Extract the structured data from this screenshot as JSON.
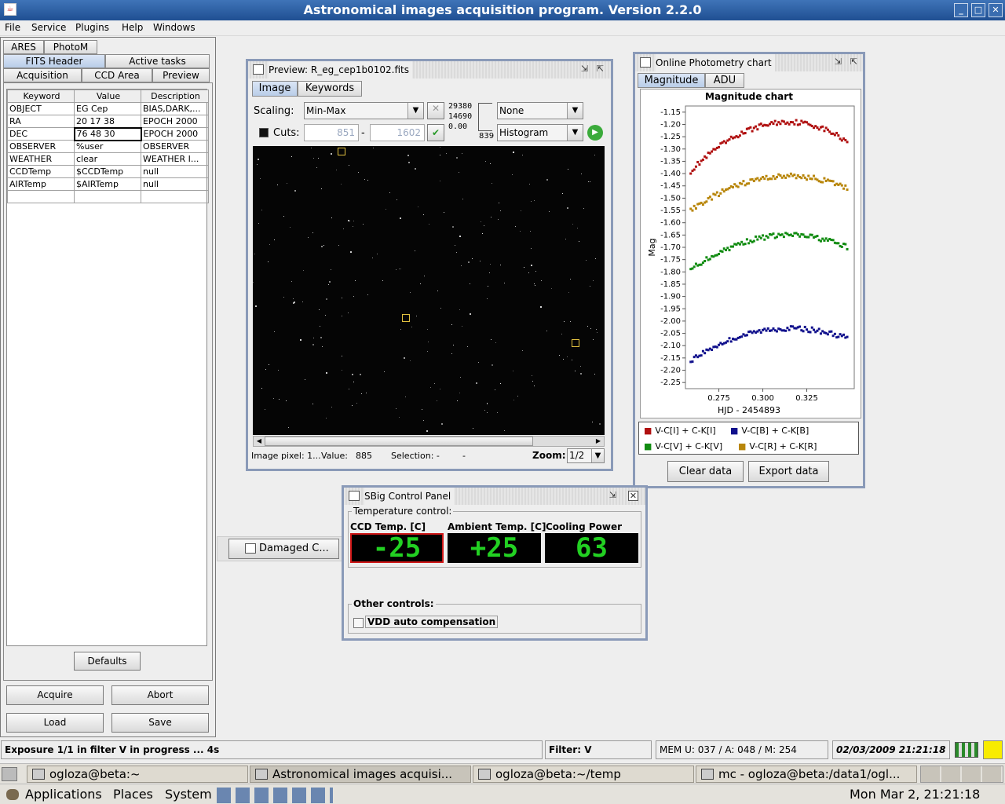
{
  "window": {
    "title": "Astronomical images acquisition program. Version 2.2.0"
  },
  "menu": [
    "File",
    "Service",
    "Plugins",
    "Help",
    "Windows"
  ],
  "left_tabs": {
    "row1": [
      "ARES",
      "PhotoM"
    ],
    "row2": [
      "FITS Header",
      "Active tasks"
    ],
    "row3": [
      "Acquisition",
      "CCD Area",
      "Preview"
    ]
  },
  "fits_table": {
    "headers": [
      "Keyword",
      "Value",
      "Description"
    ],
    "rows": [
      [
        "OBJECT",
        "EG Cep",
        "BIAS,DARK,..."
      ],
      [
        "RA",
        "20 17 38",
        "EPOCH 2000"
      ],
      [
        "DEC",
        "76 48 30",
        "EPOCH 2000"
      ],
      [
        "OBSERVER",
        "%user",
        "OBSERVER"
      ],
      [
        "WEATHER",
        "clear",
        "WEATHER I..."
      ],
      [
        "CCDTemp",
        "$CCDTemp",
        "null"
      ],
      [
        "AIRTemp",
        "$AIRTemp",
        "null"
      ]
    ]
  },
  "left_buttons": {
    "defaults": "Defaults",
    "acquire": "Acquire",
    "abort": "Abort",
    "load": "Load",
    "save": "Save"
  },
  "preview": {
    "title": "Preview: R_eg_cep1b0102.fits",
    "tabs": [
      "Image",
      "Keywords"
    ],
    "scaling_label": "Scaling:",
    "scaling_value": "Min-Max",
    "hist_values": [
      "29380",
      "14690",
      "0.00"
    ],
    "hist_right": "839",
    "filter_combo": "None",
    "cuts_label": "Cuts:",
    "cut_low": "851",
    "cut_dash": "-",
    "cut_high": "1602",
    "histogram_combo": "Histogram",
    "status_pixel": "Image pixel: 1...",
    "status_value_label": "Value:",
    "status_value": "885",
    "status_selection": "Selection: -",
    "status_selection2": "-",
    "zoom_label": "Zoom:",
    "zoom_value": "1/2"
  },
  "photometry": {
    "title": "Online Photometry chart",
    "tabs": [
      "Magnitude",
      "ADU"
    ],
    "clear_button": "Clear data",
    "export_button": "Export data"
  },
  "chart_data": {
    "type": "scatter",
    "title": "Magnitude chart",
    "xlabel": "HJD - 2454893",
    "ylabel": "Mag",
    "x_ticks": [
      "0.275",
      "0.300",
      "0.325"
    ],
    "y_ticks": [
      "-1.15",
      "-1.20",
      "-1.25",
      "-1.30",
      "-1.35",
      "-1.40",
      "-1.45",
      "-1.50",
      "-1.55",
      "-1.60",
      "-1.65",
      "-1.70",
      "-1.75",
      "-1.80",
      "-1.85",
      "-1.90",
      "-1.95",
      "-2.00",
      "-2.05",
      "-2.10",
      "-2.15",
      "-2.20",
      "-2.25"
    ],
    "xlim": [
      0.256,
      0.352
    ],
    "ylim": [
      -2.275,
      -1.125
    ],
    "series": [
      {
        "name": "V-C[I] + C-K[I]",
        "color": "#b01010",
        "peak_mag": -1.19,
        "start_mag": -1.39,
        "end_mag": -1.27
      },
      {
        "name": "V-C[B] + C-K[B]",
        "color": "#10108c",
        "peak_mag": -2.03,
        "start_mag": -2.16,
        "end_mag": -2.07
      },
      {
        "name": "V-C[V] + C-K[V]",
        "color": "#128c12",
        "peak_mag": -1.65,
        "start_mag": -1.79,
        "end_mag": -1.7
      },
      {
        "name": "V-C[R] + C-K[R]",
        "color": "#b8860b",
        "peak_mag": -1.41,
        "start_mag": -1.55,
        "end_mag": -1.46
      }
    ],
    "x_start": 0.259,
    "x_peak": 0.315,
    "x_end": 0.348
  },
  "sbig": {
    "title": "SBig Control Panel",
    "temp_group": "Temperature control:",
    "ccd_label": "CCD Temp. [C]",
    "ccd_value": "-25",
    "ambient_label": "Ambient Temp. [C]",
    "ambient_value": "+25",
    "cooling_label": "Cooling Power",
    "cooling_value": "63",
    "other_group": "Other controls:",
    "vdd_label": "VDD auto compensation"
  },
  "damaged": {
    "label": "Damaged C..."
  },
  "status": {
    "exposure": "Exposure 1/1 in filter V in progress ... 4s",
    "filter": "Filter: V",
    "mem": "MEM U: 037 / A: 048 / M: 254",
    "datetime": "02/03/2009 21:21:18"
  },
  "taskbar": [
    "ogloza@beta:~",
    "Astronomical images acquisi...",
    "ogloza@beta:~/temp",
    "mc - ogloza@beta:/data1/ogl..."
  ],
  "gnome": {
    "applications": "Applications",
    "places": "Places",
    "system": "System",
    "clock": "Mon Mar  2, 21:21:18"
  }
}
